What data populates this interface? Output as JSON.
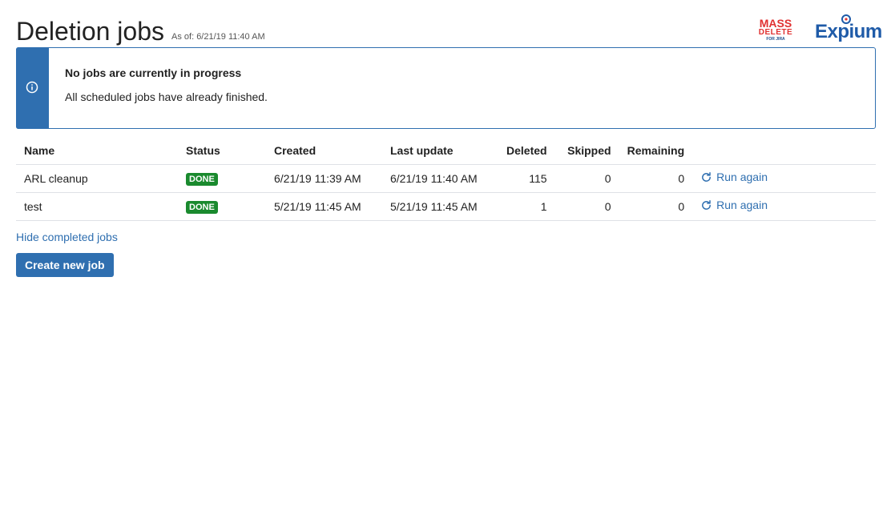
{
  "header": {
    "title": "Deletion jobs",
    "as_of_label": "As of:",
    "as_of_value": "6/21/19 11:40 AM",
    "logos": {
      "mass_delete_line1": "MASS",
      "mass_delete_line2": "DELETE",
      "mass_delete_line3": "FOR JIRA",
      "expium": "Expium"
    }
  },
  "info_panel": {
    "icon": "info-icon",
    "title": "No jobs are currently in progress",
    "text": "All scheduled jobs have already finished."
  },
  "table": {
    "columns": [
      "Name",
      "Status",
      "Created",
      "Last update",
      "Deleted",
      "Skipped",
      "Remaining",
      ""
    ],
    "rows": [
      {
        "name": "ARL cleanup",
        "status": "DONE",
        "created": "6/21/19 11:39 AM",
        "updated": "6/21/19 11:40 AM",
        "deleted": "115",
        "skipped": "0",
        "remaining": "0",
        "action": "Run again"
      },
      {
        "name": "test",
        "status": "DONE",
        "created": "5/21/19 11:45 AM",
        "updated": "5/21/19 11:45 AM",
        "deleted": "1",
        "skipped": "0",
        "remaining": "0",
        "action": "Run again"
      }
    ]
  },
  "actions": {
    "hide_completed": "Hide completed jobs",
    "create_new": "Create new job"
  },
  "colors": {
    "accent": "#2f6fb0",
    "done": "#1a8a2e",
    "brand_red": "#e03131"
  }
}
